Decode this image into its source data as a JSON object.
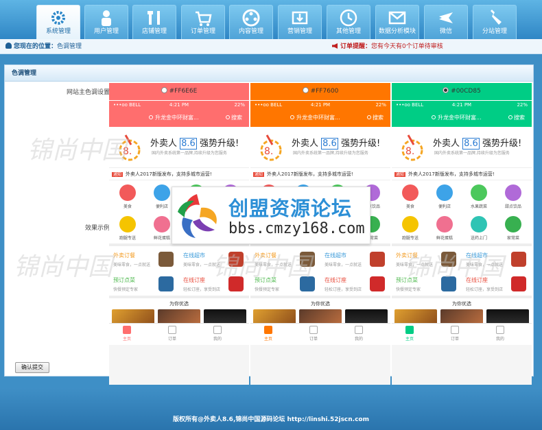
{
  "nav": {
    "tabs": [
      {
        "label": "系统管理",
        "icon": "gear-icon",
        "active": true
      },
      {
        "label": "用户管理",
        "icon": "user-icon",
        "active": false
      },
      {
        "label": "店铺管理",
        "icon": "tools-icon",
        "active": false
      },
      {
        "label": "订单管理",
        "icon": "cart-icon",
        "active": false
      },
      {
        "label": "内容管理",
        "icon": "film-icon",
        "active": false
      },
      {
        "label": "营销管理",
        "icon": "download-box-icon",
        "active": false
      },
      {
        "label": "其他管理",
        "icon": "clock-icon",
        "active": false
      },
      {
        "label": "数据分析模块",
        "icon": "envelope-icon",
        "active": false
      },
      {
        "label": "微信",
        "icon": "airplane-icon",
        "active": false
      },
      {
        "label": "分站管理",
        "icon": "wrench-icon",
        "active": false
      }
    ]
  },
  "breadcrumb": {
    "prefix": "您现在的位置：",
    "current": "色调管理"
  },
  "order_notice": {
    "label": "订单提醒：",
    "text": "您有今天有0个订单待审核"
  },
  "panel": {
    "title": "色调管理",
    "color_label": "网站主色调设置",
    "example_label": "效果示例",
    "submit_label": "确认提交"
  },
  "themes": [
    {
      "value": "#FF6E6E",
      "selected": false
    },
    {
      "value": "#FF7600",
      "selected": false
    },
    {
      "value": "#00CD85",
      "selected": true
    }
  ],
  "phone": {
    "carrier": "•••oo BELL",
    "time": "4:21 PM",
    "battery": "22%",
    "address": "升龙金中环财富...",
    "search": "搜索",
    "banner_brand": "外卖人",
    "banner_version": "8.6",
    "banner_slogan": "强势升级!",
    "banner_sub": "国内外卖系统第一品牌,持续升级为您服务",
    "notice_tag": "通知",
    "notice_text": "外卖人2017新版发布，支持多城市运营!",
    "categories": [
      {
        "label": "美食",
        "color": "#f25a5a"
      },
      {
        "label": "便利店",
        "color": "#3da3e8"
      },
      {
        "label": "水果蔬菜",
        "color": "#4cc85c"
      },
      {
        "label": "甜点饮品",
        "color": "#b06ad8"
      },
      {
        "label": "跑腿专送",
        "color": "#f5c400"
      },
      {
        "label": "鲜花蛋糕",
        "color": "#f07090"
      },
      {
        "label": "送药上门",
        "color": "#2fc4b4"
      },
      {
        "label": "家常菜",
        "color": "#38b050"
      }
    ],
    "cards": [
      {
        "title": "外卖订餐",
        "desc": "美味零食，一点就送",
        "title_color": "#f39a1e",
        "icon_color": "#7b5a3a"
      },
      {
        "title": "在线超市",
        "desc": "美味零食，一点就送",
        "title_color": "#3a9ad9",
        "icon_color": "#c0402c"
      },
      {
        "title": "预订点菜",
        "desc": "快餐预定专家",
        "title_color": "#4cb84c",
        "icon_color": "#2c6aa0"
      },
      {
        "title": "在线订座",
        "desc": "轻松订座，享受到店",
        "title_color": "#e84a3a",
        "icon_color": "#d02a2a"
      }
    ],
    "pick_title": "为你优选",
    "tabs": [
      "主页",
      "订单",
      "我的"
    ]
  },
  "watermark": {
    "brand_cn": "创盟资源论坛",
    "brand_url": "bbs.cmzy168.com",
    "faint": "锦尚中国"
  },
  "footer": {
    "copyright": "版权所有@外卖人8.6,锦尚中国源码论坛 http://linshi.52jscn.com"
  }
}
